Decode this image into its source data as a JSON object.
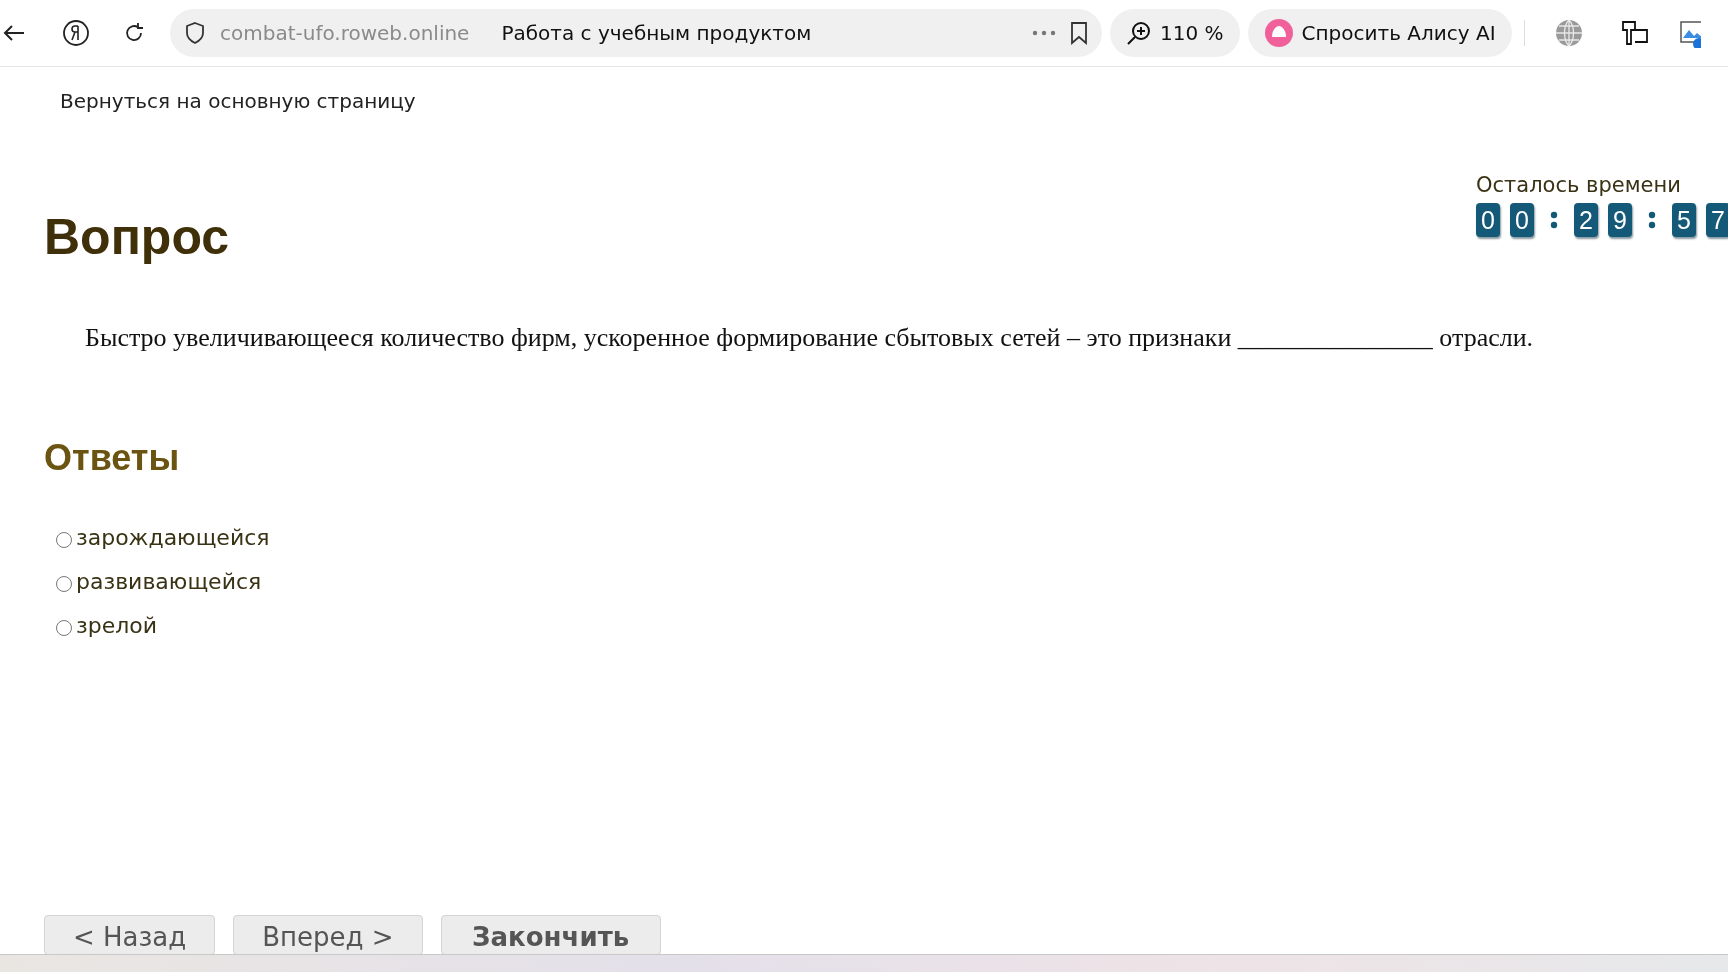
{
  "browser": {
    "url": "combat-ufo.roweb.online",
    "page_title": "Работа с учебным продуктом",
    "zoom": "110 %",
    "assistant_button": "Спросить Алису AI"
  },
  "header": {
    "back_link": "Вернуться на основную страницу"
  },
  "timer": {
    "label": "Осталось времени",
    "groups": [
      [
        "0",
        "0"
      ],
      [
        "2",
        "9"
      ],
      [
        "5",
        "7"
      ]
    ]
  },
  "question": {
    "heading": "Вопрос",
    "text": "Быстро увеличивающееся количество фирм, ускоренное формирование сбытовых сетей – это признаки _______________ отрасли."
  },
  "answers": {
    "heading": "Ответы",
    "options": [
      {
        "label": "зарождающейся",
        "selected": false
      },
      {
        "label": "развивающейся",
        "selected": false
      },
      {
        "label": "зрелой",
        "selected": false
      }
    ]
  },
  "buttons": [
    {
      "label": "< Назад",
      "kind": "nav"
    },
    {
      "label": "Вперед >",
      "kind": "nav"
    },
    {
      "label": "Закончить",
      "kind": "finish"
    }
  ]
}
